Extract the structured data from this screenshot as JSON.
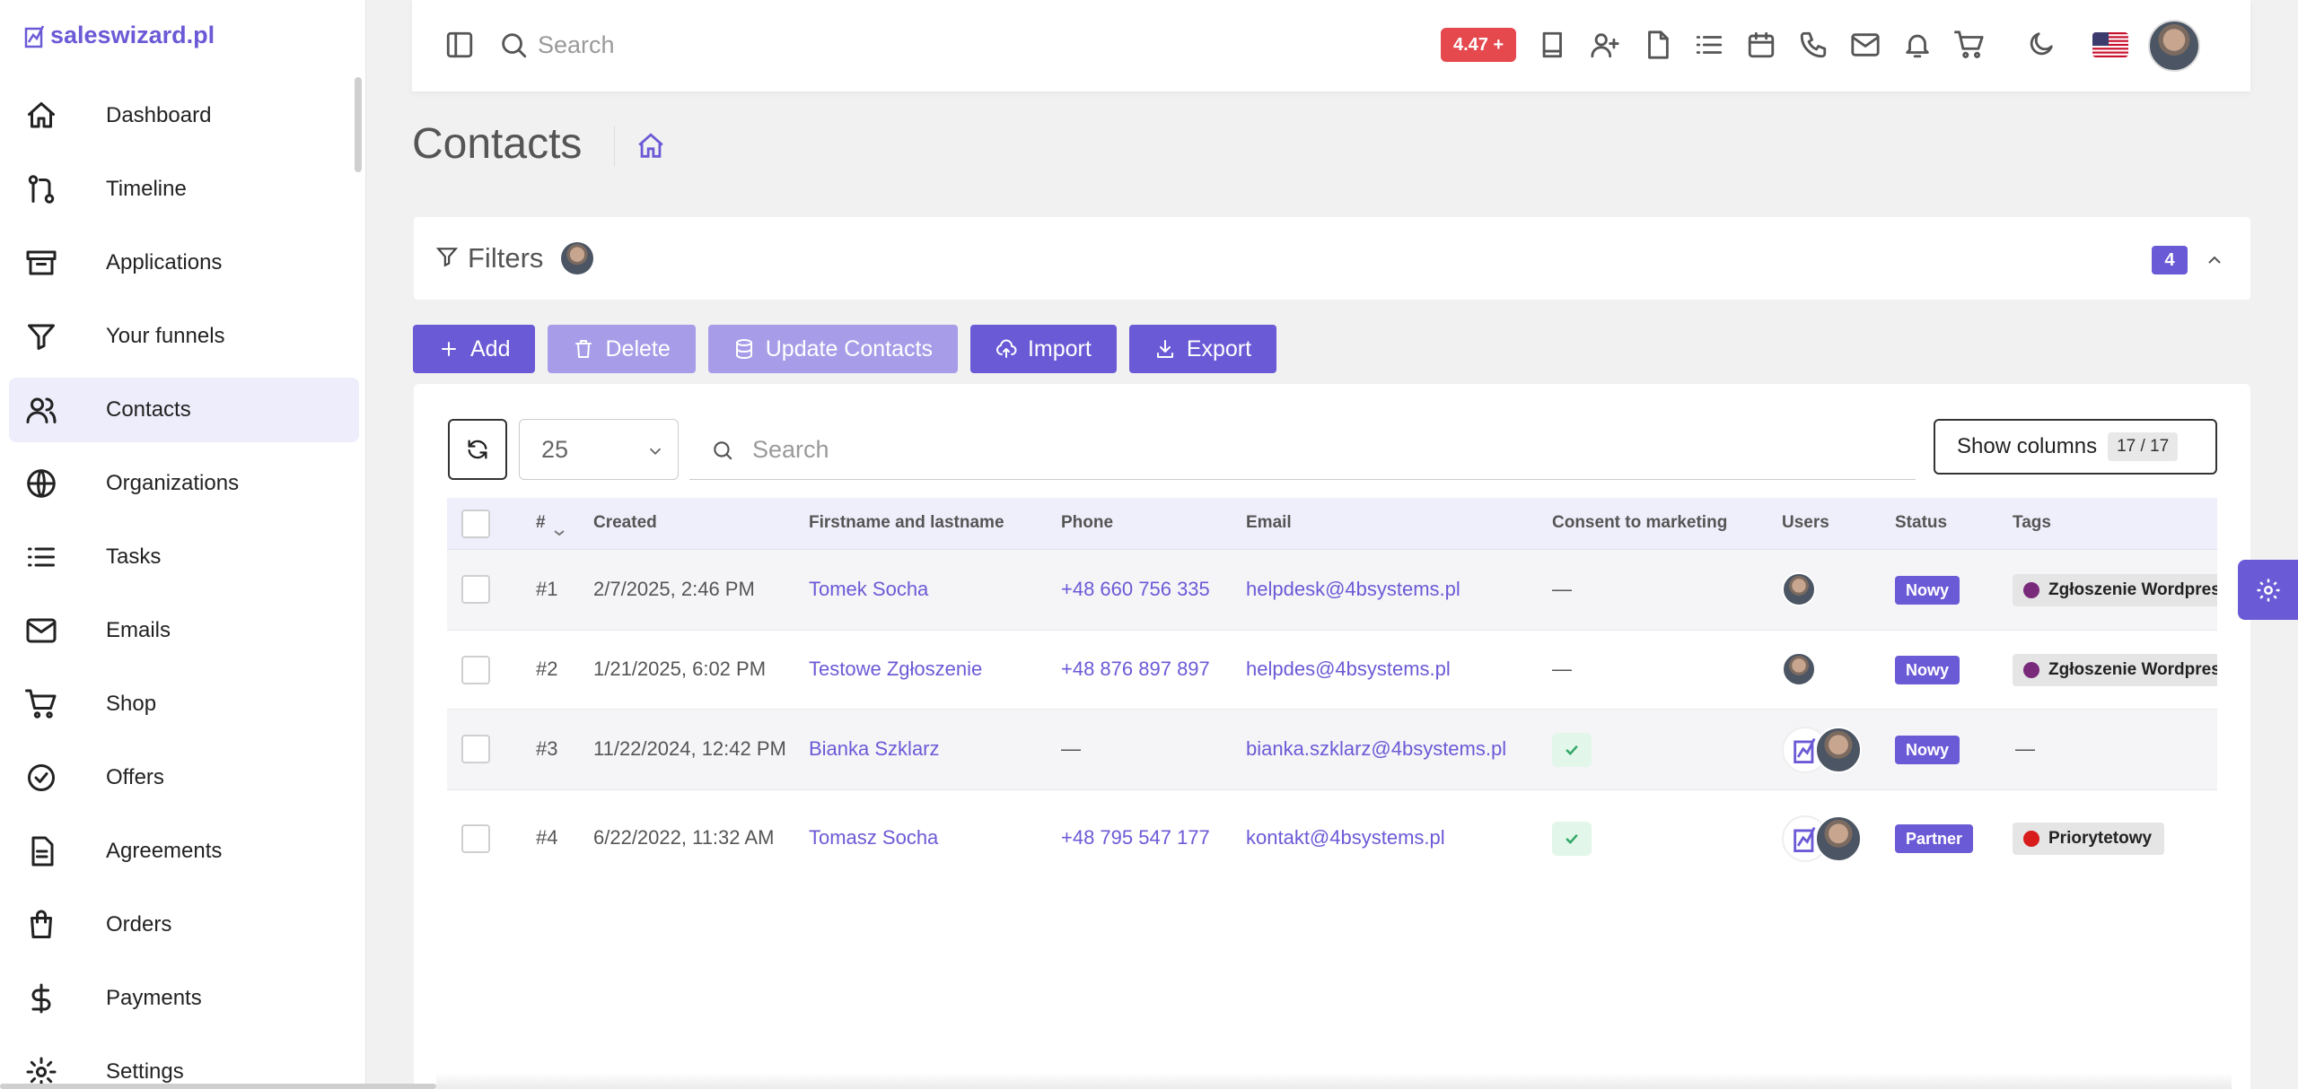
{
  "brand": {
    "name": "saleswizard.pl",
    "color": "#6b5ad6"
  },
  "sidebar": {
    "items": [
      {
        "label": "Dashboard",
        "icon": "home-icon"
      },
      {
        "label": "Timeline",
        "icon": "git-pull-icon"
      },
      {
        "label": "Applications",
        "icon": "archive-icon"
      },
      {
        "label": "Your funnels",
        "icon": "funnel-icon"
      },
      {
        "label": "Contacts",
        "icon": "users-icon",
        "active": true
      },
      {
        "label": "Organizations",
        "icon": "globe-icon"
      },
      {
        "label": "Tasks",
        "icon": "list-icon"
      },
      {
        "label": "Emails",
        "icon": "mail-icon"
      },
      {
        "label": "Shop",
        "icon": "cart-icon"
      },
      {
        "label": "Offers",
        "icon": "badge-check-icon"
      },
      {
        "label": "Agreements",
        "icon": "document-icon"
      },
      {
        "label": "Orders",
        "icon": "shopping-bag-icon"
      },
      {
        "label": "Payments",
        "icon": "dollar-icon"
      },
      {
        "label": "Settings",
        "icon": "gear-icon"
      }
    ]
  },
  "topbar": {
    "search_placeholder": "Search",
    "version_badge": "4.47 +",
    "icons": [
      "book-icon",
      "user-plus-icon",
      "file-icon",
      "list-icon",
      "calendar-icon",
      "phone-icon",
      "mail-icon",
      "bell-icon",
      "cart-icon"
    ],
    "theme_icon": "moon-icon",
    "language_flag": "us-flag-icon"
  },
  "page": {
    "title": "Contacts"
  },
  "filters": {
    "label": "Filters",
    "count": "4"
  },
  "actions": {
    "add": "Add",
    "delete": "Delete",
    "update": "Update Contacts",
    "import": "Import",
    "export": "Export"
  },
  "table_controls": {
    "page_size": "25",
    "search_placeholder": "Search",
    "show_columns_label": "Show columns",
    "show_columns_count": "17 / 17"
  },
  "table": {
    "columns": [
      "#",
      "Created",
      "Firstname and lastname",
      "Phone",
      "Email",
      "Consent to marketing",
      "Users",
      "Status",
      "Tags"
    ],
    "rows": [
      {
        "id": "#1",
        "created": "2/7/2025, 2:46 PM",
        "name": "Tomek Socha",
        "phone": "+48 660 756 335",
        "email": "helpdesk@4bsystems.pl",
        "consent": "—",
        "status": "Nowy",
        "tag": "Zgłoszenie Wordpress",
        "tag_color": "#7a2a7a"
      },
      {
        "id": "#2",
        "created": "1/21/2025, 6:02 PM",
        "name": "Testowe Zgłoszenie",
        "phone": "+48 876 897 897",
        "email": "helpdes@4bsystems.pl",
        "consent": "—",
        "status": "Nowy",
        "tag": "Zgłoszenie Wordpress",
        "tag_color": "#7a2a7a"
      },
      {
        "id": "#3",
        "created": "11/22/2024, 12:42 PM",
        "name": "Bianka Szklarz",
        "phone": "—",
        "email": "bianka.szklarz@4bsystems.pl",
        "consent": "yes",
        "status": "Nowy",
        "tag": "—",
        "tag_color": ""
      },
      {
        "id": "#4",
        "created": "6/22/2022, 11:32 AM",
        "name": "Tomasz Socha",
        "phone": "+48 795 547 177",
        "email": "kontakt@4bsystems.pl",
        "consent": "yes",
        "status": "Partner",
        "tag": "Priorytetowy",
        "tag_color": "#d81b1b"
      }
    ]
  },
  "colors": {
    "accent": "#6b5ad6",
    "accent_disabled": "#a79ce8",
    "badge_red": "#e5484d",
    "consent_green": "#2fa764"
  }
}
